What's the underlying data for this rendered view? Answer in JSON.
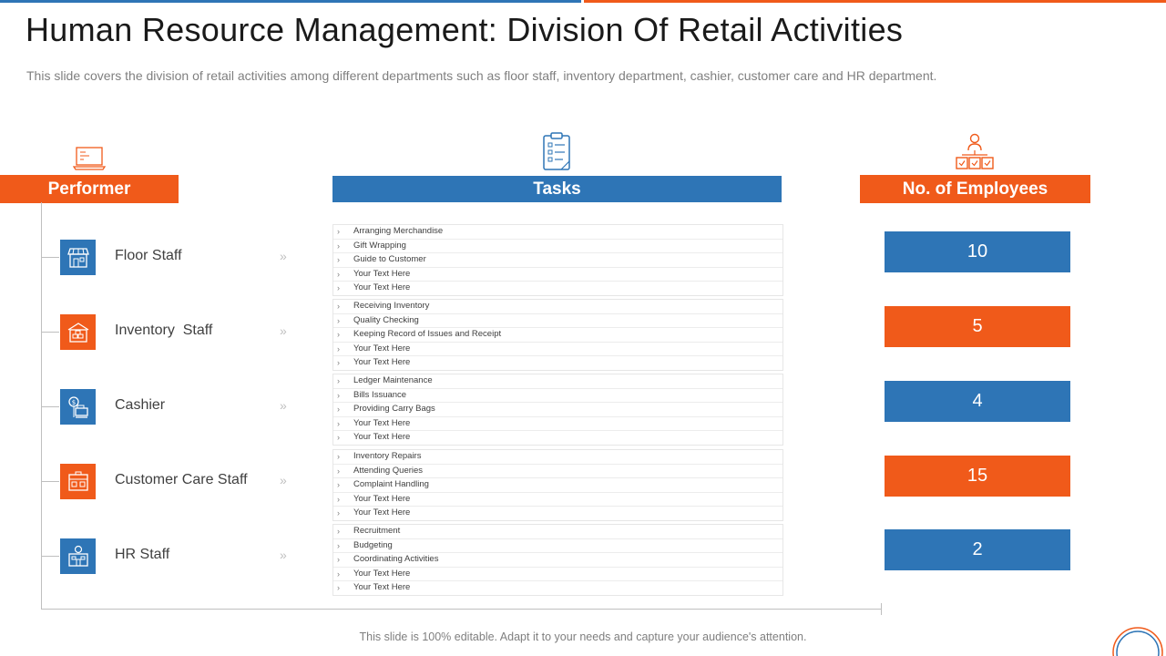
{
  "title": "Human Resource Management: Division Of Retail Activities",
  "subtitle": "This slide covers the division of retail activities among different departments such as floor staff, inventory department, cashier, customer care and HR department.",
  "headers": {
    "performer": "Performer",
    "tasks": "Tasks",
    "employees": "No. of Employees"
  },
  "icons": {
    "performer_header": "laptop-icon",
    "tasks_header": "clipboard-checklist-icon",
    "employees_header": "org-chart-icon"
  },
  "colors": {
    "blue": "#2e75b6",
    "orange": "#f05a1a"
  },
  "rows": [
    {
      "performer": "Floor Staff",
      "icon": "storefront-icon",
      "color": "blue",
      "employees": "10",
      "tasks": [
        "Arranging Merchandise",
        "Gift Wrapping",
        "Guide to Customer",
        "Your Text Here",
        "Your Text Here"
      ]
    },
    {
      "performer": "Inventory  Staff",
      "icon": "warehouse-icon",
      "color": "orange",
      "employees": "5",
      "tasks": [
        "Receiving Inventory",
        "Quality Checking",
        "Keeping Record of Issues and Receipt",
        "Your Text Here",
        "Your Text Here"
      ]
    },
    {
      "performer": "Cashier",
      "icon": "cash-counter-icon",
      "color": "blue",
      "employees": "4",
      "tasks": [
        "Ledger Maintenance",
        "Bills Issuance",
        "Providing Carry Bags",
        "Your Text Here",
        "Your Text Here"
      ]
    },
    {
      "performer": "Customer Care Staff",
      "icon": "service-desk-icon",
      "color": "orange",
      "employees": "15",
      "tasks": [
        "Inventory Repairs",
        "Attending Queries",
        "Complaint Handling",
        "Your Text Here",
        "Your Text Here"
      ]
    },
    {
      "performer": "HR Staff",
      "icon": "office-building-icon",
      "color": "blue",
      "employees": "2",
      "tasks": [
        "Recruitment",
        "Budgeting",
        "Coordinating Activities",
        "Your Text Here",
        "Your Text Here"
      ]
    }
  ],
  "footer": "This slide is 100% editable. Adapt it to your needs and capture your audience's attention."
}
